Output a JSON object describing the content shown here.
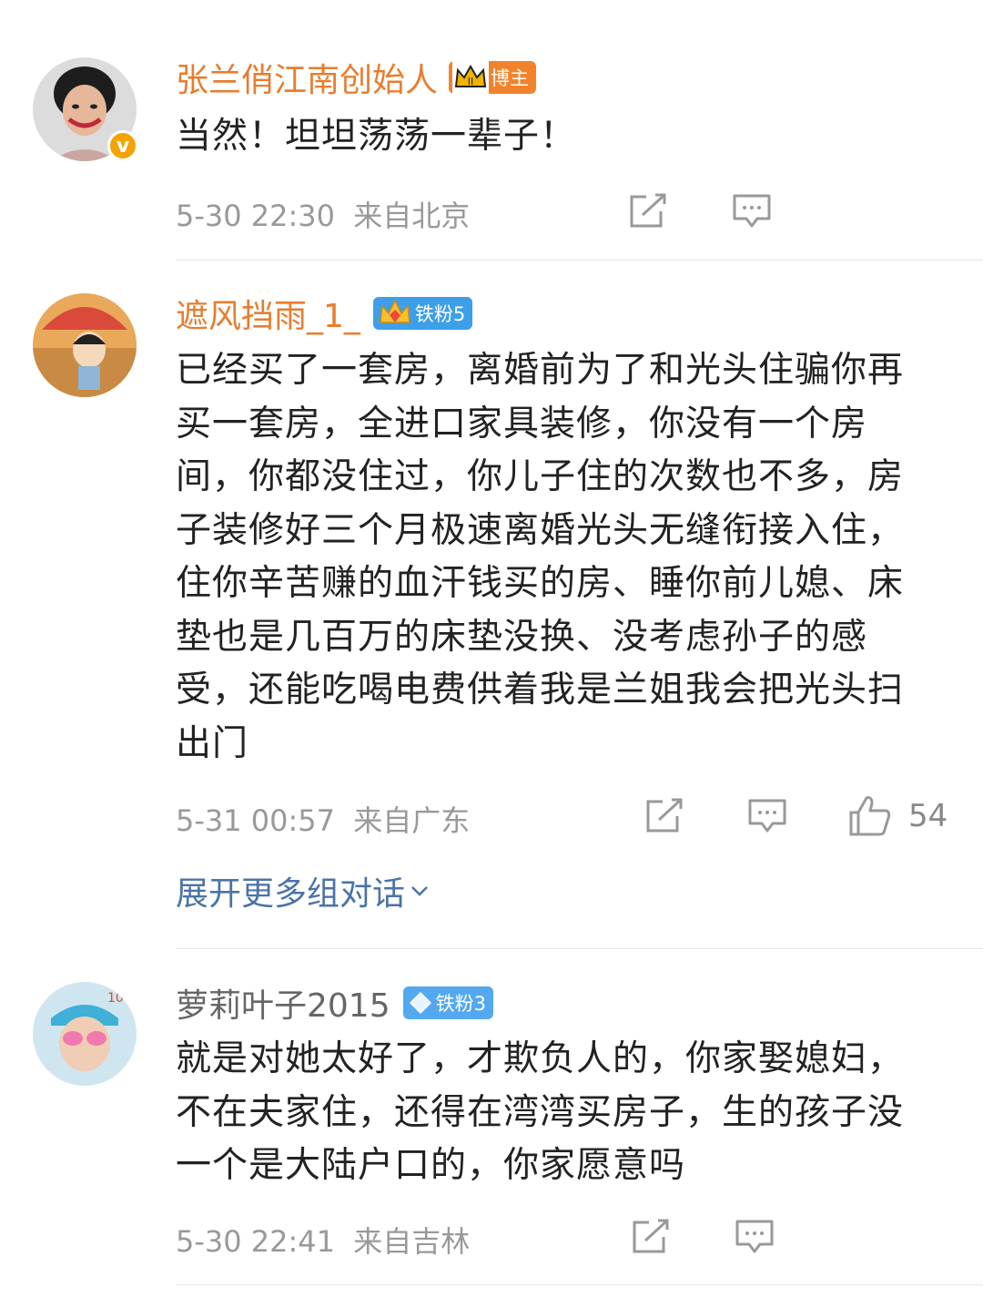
{
  "colors": {
    "orange_name": "#e87d2e",
    "gray_name": "#666666",
    "link": "#4a73a8",
    "meta": "#999999",
    "blogger_badge": "#f2832c",
    "fan_badge": "#3d9fe8",
    "verified": "#f5a300"
  },
  "comments": [
    {
      "username": "张兰俏江南创始人",
      "badge_label": "博主",
      "badge_icon": "crown-v-icon",
      "text": "当然！坦坦荡荡一辈子！",
      "date": "5-30 22:30",
      "location": "来自北京",
      "actions": [
        "share-icon",
        "comment-icon"
      ]
    },
    {
      "username": "遮风挡雨_1_",
      "badge_label": "铁粉5",
      "badge_icon": "crown-diamond-icon",
      "text": "已经买了一套房，离婚前为了和光头住骗你再买一套房，全进口家具装修，你没有一个房间，你都没住过，你儿子住的次数也不多，房子装修好三个月极速离婚光头无缝衔接入住，住你辛苦赚的血汗钱买的房、睡你前儿媳、床垫也是几百万的床垫没换、没考虑孙子的感受，还能吃喝电费供着我是兰姐我会把光头扫出门",
      "date": "5-31 00:57",
      "location": "来自广东",
      "actions": [
        "share-icon",
        "comment-icon",
        "like-icon"
      ],
      "like_count": "54",
      "expand_label": "展开更多组对话"
    },
    {
      "username": "萝莉叶子2015",
      "badge_label": "铁粉3",
      "badge_icon": "diamond-icon",
      "text": "就是对她太好了，才欺负人的，你家娶媳妇，不在夫家住，还得在湾湾买房子，生的孩子没一个是大陆户口的，你家愿意吗",
      "date": "5-30 22:41",
      "location": "来自吉林",
      "actions": [
        "share-icon",
        "comment-icon"
      ]
    }
  ]
}
